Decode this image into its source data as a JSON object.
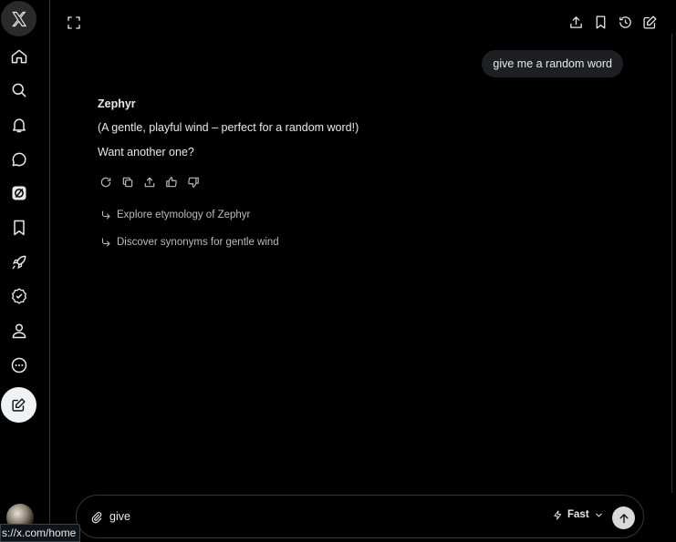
{
  "sidebar": {
    "items": [
      {
        "name": "x-logo-icon"
      },
      {
        "name": "home-icon"
      },
      {
        "name": "search-icon"
      },
      {
        "name": "bell-icon"
      },
      {
        "name": "messages-icon"
      },
      {
        "name": "grok-icon"
      },
      {
        "name": "bookmark-icon"
      },
      {
        "name": "rocket-icon"
      },
      {
        "name": "verified-icon"
      },
      {
        "name": "profile-icon"
      },
      {
        "name": "more-icon"
      },
      {
        "name": "compose-icon"
      }
    ]
  },
  "chat": {
    "user_message": "give me a random word",
    "response_title": "Zephyr",
    "response_line1": "(A gentle, playful wind – perfect for a random word!)",
    "response_line2": "Want another one?",
    "suggestions": [
      "Explore etymology of Zephyr",
      "Discover synonyms for gentle wind"
    ]
  },
  "composer": {
    "text": "give",
    "model": "Fast"
  },
  "status_url": "s://x.com/home"
}
